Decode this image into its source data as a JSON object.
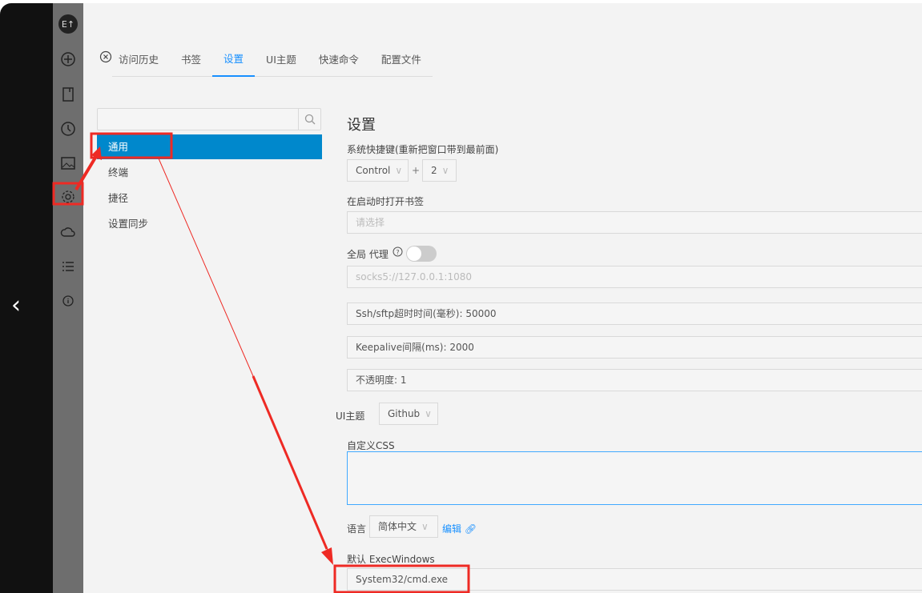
{
  "nav_back": "‹",
  "sidebar_icons": [
    "logo-icon",
    "add-icon",
    "bookmark-icon",
    "history-icon",
    "image-icon",
    "gear-icon",
    "cloud-sync-icon",
    "list-icon",
    "info-icon"
  ],
  "logo_text": "E↑",
  "tabs": [
    {
      "label": "访问历史"
    },
    {
      "label": "书签"
    },
    {
      "label": "设置"
    },
    {
      "label": "UI主题"
    },
    {
      "label": "快速命令"
    },
    {
      "label": "配置文件"
    }
  ],
  "settings_nav": [
    {
      "label": "通用"
    },
    {
      "label": "终端"
    },
    {
      "label": "捷径"
    },
    {
      "label": "设置同步"
    }
  ],
  "form": {
    "title": "设置",
    "hotkey_label": "系统快捷键(重新把窗口带到最前面)",
    "hotkey_mod": "Control",
    "plus": "+",
    "hotkey_key": "2",
    "bookmark_label": "在启动时打开书签",
    "bookmark_placeholder": "请选择",
    "proxy_label": "全局 代理",
    "proxy_enabled": false,
    "proxy_placeholder": "socks5://127.0.0.1:1080",
    "timeout": "Ssh/sftp超时时间(毫秒): 50000",
    "keepalive": "Keepalive间隔(ms): 2000",
    "opacity": "不透明度: 1",
    "theme_label": "UI主题",
    "theme_value": "Github",
    "css_label": "自定义CSS",
    "lang_label": "语言",
    "lang_value": "简体中文",
    "edit_link": "编辑",
    "exec_label": "默认 ExecWindows",
    "exec_value": "System32/cmd.exe"
  },
  "colors": {
    "accent": "#0088cc",
    "annotation": "#ee2a24"
  }
}
